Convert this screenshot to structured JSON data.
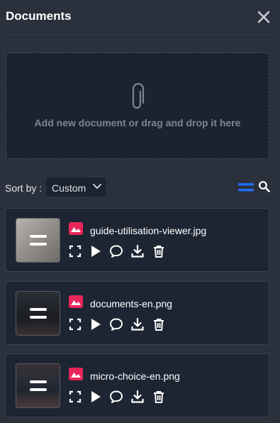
{
  "header": {
    "title": "Documents",
    "close_icon": "close-icon"
  },
  "dropzone": {
    "text": "Add new document or drag and drop it here",
    "icon": "paperclip-icon"
  },
  "sort": {
    "label": "Sort by :",
    "selected": "Custom",
    "list_icon": "list-view-icon",
    "search_icon": "search-icon"
  },
  "colors": {
    "accent": "#1e6df5",
    "image_type": "#e8265a",
    "background": "#2a303c",
    "card": "#1e2532"
  },
  "documents": [
    {
      "name": "guide-utilisation-viewer.jpg",
      "type_icon": "image-icon"
    },
    {
      "name": "documents-en.png",
      "type_icon": "image-icon"
    },
    {
      "name": "micro-choice-en.png",
      "type_icon": "image-icon"
    }
  ],
  "actions": [
    "fullscreen-icon",
    "play-icon",
    "comment-icon",
    "download-icon",
    "delete-icon"
  ]
}
